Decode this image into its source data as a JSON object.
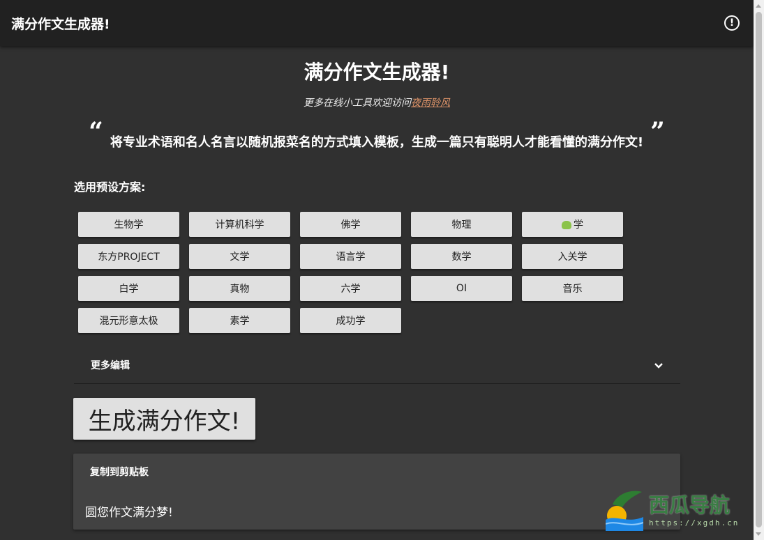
{
  "appbar": {
    "title": "满分作文生成器!",
    "info_icon": "info-icon"
  },
  "main": {
    "title": "满分作文生成器!",
    "subtitle_prefix": "更多在线小工具欢迎访问",
    "subtitle_link": "夜雨聆风",
    "quote_open": "“",
    "quote_text": "将专业术语和名人名言以随机报菜名的方式填入模板，生成一篇只有聪明人才能看懂的满分作文!",
    "quote_close": "”"
  },
  "presets": {
    "label": "选用预设方案:",
    "items": [
      "生物学",
      "计算机科学",
      "佛学",
      "物理",
      "学",
      "东方PROJECT",
      "文学",
      "语言学",
      "数学",
      "入关学",
      "白学",
      "真物",
      "六学",
      "OI",
      "音乐",
      "混元形意太极",
      "素学",
      "成功学"
    ]
  },
  "expander": {
    "label": "更多编辑",
    "icon": "chevron-down-icon"
  },
  "generate": {
    "label": "生成满分作文!"
  },
  "result": {
    "copy_label": "复制到剪贴板",
    "essay": "圆您作文满分梦!"
  },
  "watermark": {
    "name": "西瓜导航",
    "url": "https://xgdh.cn"
  },
  "colors": {
    "background": "#303030",
    "appbar": "#212121",
    "button": "#e0e0e0",
    "card": "#424242",
    "link": "#e0956a"
  }
}
